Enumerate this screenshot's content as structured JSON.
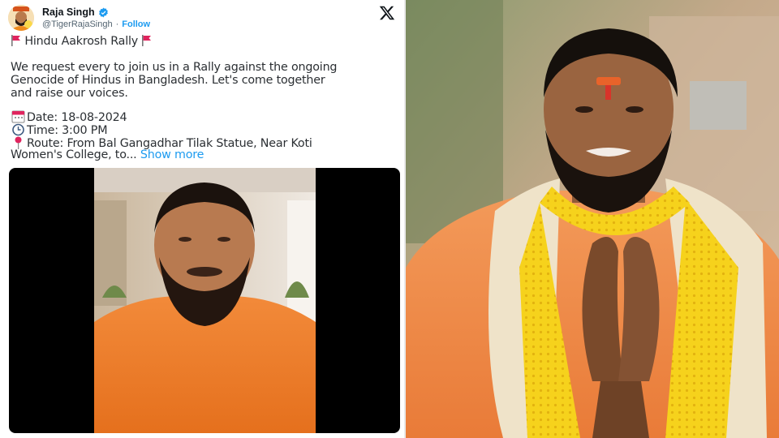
{
  "tweet": {
    "display_name": "Raja Singh",
    "handle": "@TigerRajaSingh",
    "separator": "·",
    "follow_label": "Follow",
    "title": "Hindu Aakrosh Rally",
    "paragraph_lines": [
      "We request every to join us in a Rally against the ongoing",
      "Genocide of Hindus in Bangladesh. Let's come together",
      "and raise our voices."
    ],
    "date_text": "Date: 18-08-2024",
    "time_text": "Time: 3:00 PM",
    "route_line1": "Route: From Bal Gangadhar Tilak Statue, Near Koti",
    "route_line2": "Women's College, to...",
    "show_more_label": "Show more"
  },
  "icons": {
    "verified": "verified-badge-icon",
    "x_logo": "x-logo-icon",
    "flag": "red-flag-icon",
    "calendar": "calendar-icon",
    "clock": "clock-icon",
    "pin": "round-pushpin-icon"
  },
  "colors": {
    "accent": "#1d9bf0",
    "text": "#0f1419",
    "muted": "#536471",
    "saffron": "#e8741f",
    "scarf_yellow": "#f5d21a"
  }
}
